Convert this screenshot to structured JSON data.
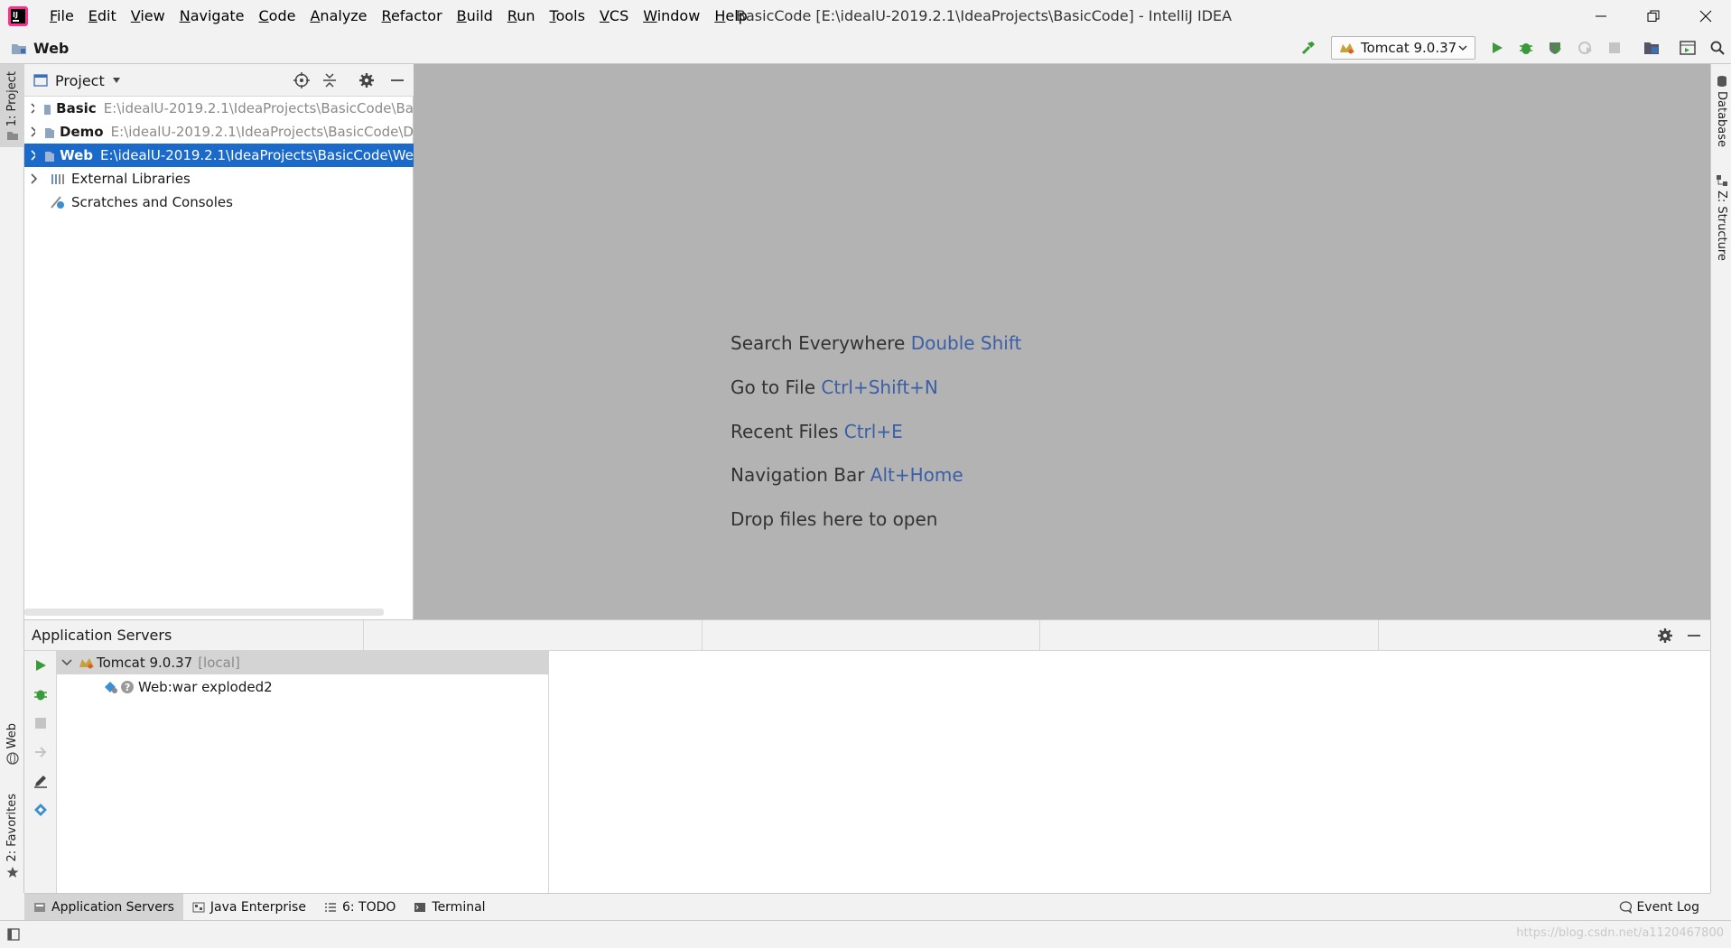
{
  "window": {
    "title": "BasicCode [E:\\idealU-2019.2.1\\IdeaProjects\\BasicCode] - IntelliJ IDEA"
  },
  "menu": [
    "File",
    "Edit",
    "View",
    "Navigate",
    "Code",
    "Analyze",
    "Refactor",
    "Build",
    "Run",
    "Tools",
    "VCS",
    "Window",
    "Help"
  ],
  "navbar": {
    "crumb": "Web",
    "run_config": "Tomcat 9.0.37"
  },
  "left_stripe": {
    "project_tab": "1: Project",
    "web_tab": "Web",
    "favorites_tab": "2: Favorites"
  },
  "right_stripe": {
    "database_tab": "Database",
    "structure_tab": "Z: Structure"
  },
  "project_panel": {
    "title": "Project",
    "items": [
      {
        "name": "Basic",
        "path": "E:\\idealU-2019.2.1\\IdeaProjects\\BasicCode\\Ba",
        "selected": false
      },
      {
        "name": "Demo",
        "path": "E:\\idealU-2019.2.1\\IdeaProjects\\BasicCode\\D",
        "selected": false
      },
      {
        "name": "Web",
        "path": "E:\\idealU-2019.2.1\\IdeaProjects\\BasicCode\\We",
        "selected": true
      }
    ],
    "external_libraries": "External Libraries",
    "scratches": "Scratches and Consoles"
  },
  "editor": {
    "hints": [
      {
        "text": "Search Everywhere",
        "key": "Double Shift"
      },
      {
        "text": "Go to File",
        "key": "Ctrl+Shift+N"
      },
      {
        "text": "Recent Files",
        "key": "Ctrl+E"
      },
      {
        "text": "Navigation Bar",
        "key": "Alt+Home"
      },
      {
        "text": "Drop files here to open",
        "key": ""
      }
    ]
  },
  "app_servers": {
    "title": "Application Servers",
    "server_name": "Tomcat 9.0.37",
    "server_suffix": "[local]",
    "artifact": "Web:war exploded2"
  },
  "bottom_tabs": [
    {
      "label": "Application Servers",
      "active": true
    },
    {
      "label": "Java Enterprise",
      "active": false
    },
    {
      "label": "6: TODO",
      "active": false
    },
    {
      "label": "Terminal",
      "active": false
    }
  ],
  "event_log": "Event Log",
  "watermark": "https://blog.csdn.net/a1120467800",
  "colors": {
    "selection": "#1b6ac9",
    "shortcut": "#3b5fa6",
    "run_green": "#3a9a3a"
  }
}
